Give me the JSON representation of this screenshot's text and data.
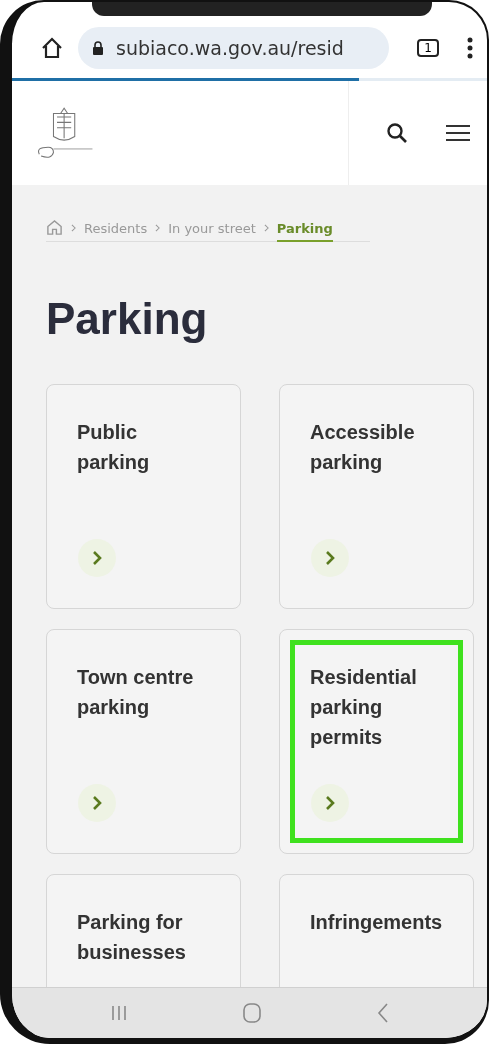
{
  "browser": {
    "url": "subiaco.wa.gov.au/resid",
    "tab_count": "1",
    "level": 0.73
  },
  "breadcrumb": [
    {
      "label": "Residents",
      "selected": false
    },
    {
      "label": "In your street",
      "selected": false
    },
    {
      "label": "Parking",
      "selected": true
    }
  ],
  "title": "Parking",
  "cards": [
    {
      "title": "Public parking",
      "highlighted": false
    },
    {
      "title": "Accessible parking",
      "highlighted": false
    },
    {
      "title": "Town centre parking",
      "highlighted": false
    },
    {
      "title": "Residential parking permits",
      "highlighted": true
    },
    {
      "title": "Parking for businesses",
      "highlighted": false
    },
    {
      "title": "Infringements",
      "highlighted": false
    }
  ]
}
